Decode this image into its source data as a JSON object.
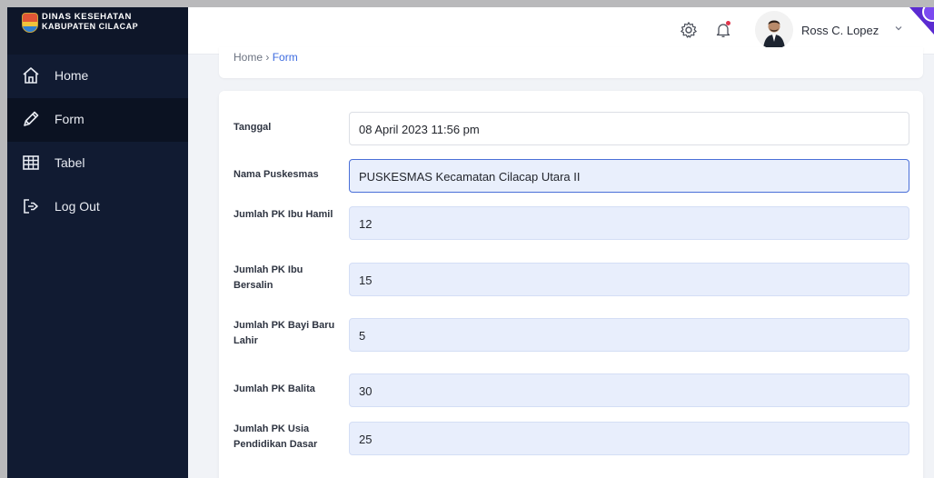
{
  "brand": {
    "line1": "DINAS KESEHATAN",
    "line2": "KABUPATEN CILACAP"
  },
  "sidebar": {
    "items": [
      {
        "label": "Home",
        "icon": "home-icon"
      },
      {
        "label": "Form",
        "icon": "pen-icon",
        "active": true
      },
      {
        "label": "Tabel",
        "icon": "table-icon"
      },
      {
        "label": "Log Out",
        "icon": "logout-icon"
      }
    ]
  },
  "topbar": {
    "user_name": "Ross C. Lopez",
    "icons": [
      "gear-icon",
      "bell-icon",
      "avatar",
      "chevron-down-icon"
    ]
  },
  "breadcrumb": {
    "home": "Home",
    "separator": "›",
    "current": "Form"
  },
  "form": {
    "fields": [
      {
        "label": "Tanggal",
        "value": "08 April 2023 11:56 pm"
      },
      {
        "label": "Nama Puskesmas",
        "value": "PUSKESMAS Kecamatan Cilacap Utara II"
      },
      {
        "label": "Jumlah PK Ibu Hamil",
        "value": "12"
      },
      {
        "label": "Jumlah PK Ibu Bersalin",
        "value": "15"
      },
      {
        "label": "Jumlah PK Bayi Baru Lahir",
        "value": "5"
      },
      {
        "label": "Jumlah PK Balita",
        "value": "30"
      },
      {
        "label": "Jumlah PK Usia Pendidikan Dasar",
        "value": "25"
      }
    ]
  },
  "colors": {
    "sidebar_bg": "#111b32",
    "accent": "#3d6be0",
    "field_filled_bg": "#e8eefc"
  }
}
